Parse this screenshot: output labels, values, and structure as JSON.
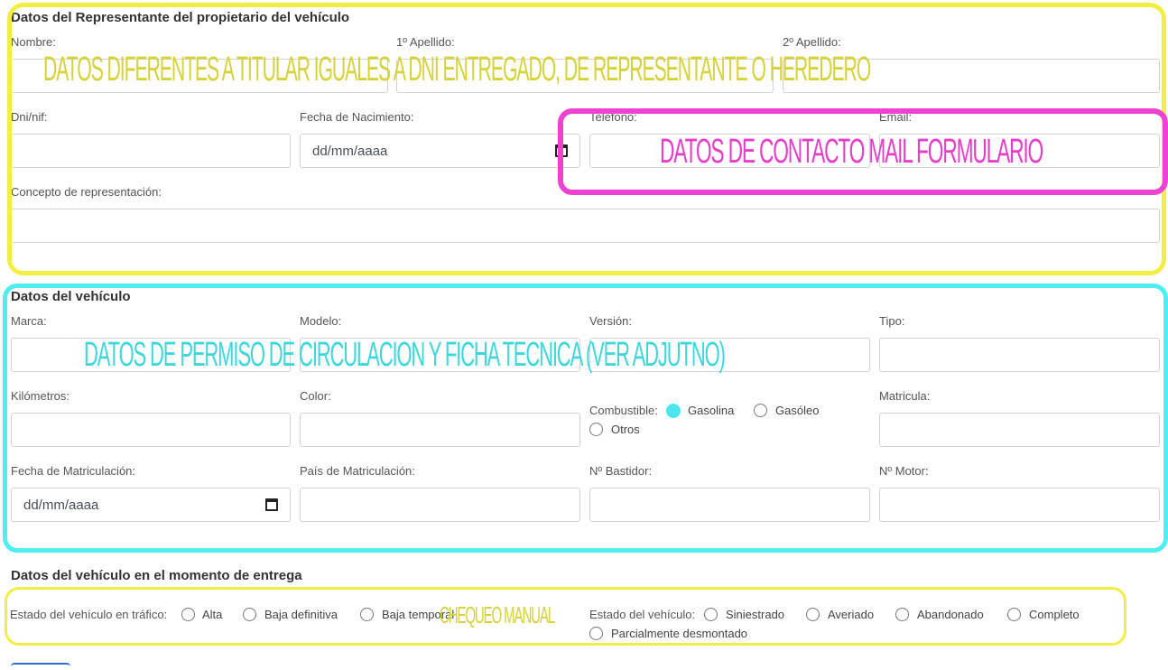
{
  "section_rep": {
    "title": "Datos del Representante del propietario del vehículo",
    "nombre": "Nombre:",
    "apellido1": "1º Apellido:",
    "apellido2": "2º Apellido:",
    "dni": "Dni/nif:",
    "fecha_nac": "Fecha de Nacimiento:",
    "telefono": "Telefono:",
    "email": "Email:",
    "concepto": "Concepto de representación:",
    "date_placeholder": "dd/mm/aaaa"
  },
  "section_vehiculo": {
    "title": "Datos del vehículo",
    "marca": "Marca:",
    "modelo": "Modelo:",
    "version": "Versión:",
    "tipo": "Tipo:",
    "kilometros": "Kilómetros:",
    "color": "Color:",
    "combustible": "Combustible:",
    "combustible_options": [
      "Gasolina",
      "Gasóleo",
      "Otros"
    ],
    "combustible_selected": "Gasolina",
    "matricula": "Matricula:",
    "fecha_matriculacion": "Fecha de Matriculación:",
    "pais_matriculacion": "País de Matriculación:",
    "bastidor": "Nº Bastidor:",
    "motor": "Nº Motor:",
    "date_placeholder": "dd/mm/aaaa"
  },
  "section_entrega": {
    "title": "Datos del vehículo en el momento de entrega",
    "estado_trafico": "Estado del vehículo en tráfico:",
    "estado_trafico_options": [
      "Alta",
      "Baja definitiva",
      "Baja temporal"
    ],
    "estado_vehiculo": "Estado del vehículo:",
    "estado_vehiculo_options": [
      "Siniestrado",
      "Averiado",
      "Abandonado",
      "Completo",
      "Parcialmente desmontado"
    ]
  },
  "annotations": {
    "representante": "DATOS DIFERENTES A TITULAR IGUALES A DNI ENTREGADO, DE REPRESENTANTE O HEREDERO",
    "contacto": "DATOS DE CONTACTO MAIL FORMULARIO",
    "vehiculo": "DATOS DE PERMISO DE CIRCULACION Y FICHA TECNICA (VER ADJUTNO)",
    "chequeo": "CHEQUEO MANUAL"
  },
  "colors": {
    "annotation_yellow": "#d6d23a",
    "annotation_magenta": "#e53fc9",
    "annotation_cyan": "#3fd7dc",
    "radio_checked": "#4ee6ee"
  }
}
